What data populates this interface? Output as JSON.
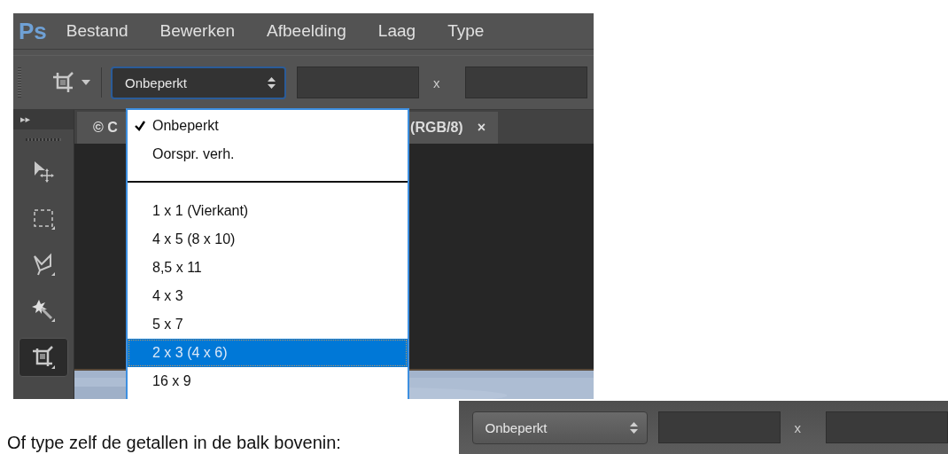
{
  "app_window": {
    "logo": "Ps",
    "menu": [
      {
        "label": "Bestand"
      },
      {
        "label": "Bewerken"
      },
      {
        "label": "Afbeelding"
      },
      {
        "label": "Laag"
      },
      {
        "label": "Type"
      }
    ],
    "options_bar": {
      "preset": "Onbeperkt",
      "separator": "x"
    },
    "tools": [
      {
        "kind": "move",
        "selected": false
      },
      {
        "kind": "marquee",
        "selected": false
      },
      {
        "kind": "lasso",
        "selected": false
      },
      {
        "kind": "wand",
        "selected": false
      },
      {
        "kind": "crop",
        "selected": true
      }
    ],
    "panel_toggle": "▸▸",
    "document_tab": {
      "title_start": "© C",
      "title_end": "(RGB/8)",
      "close": "×"
    },
    "dropdown": {
      "groups": [
        [
          {
            "label": "Onbeperkt",
            "checked": true,
            "selected": false
          },
          {
            "label": "Oorspr. verh.",
            "checked": false,
            "selected": false
          }
        ],
        [
          {
            "label": "1 x 1 (Vierkant)",
            "checked": false,
            "selected": false
          },
          {
            "label": "4 x 5 (8 x 10)",
            "checked": false,
            "selected": false
          },
          {
            "label": "8,5 x 11",
            "checked": false,
            "selected": false
          },
          {
            "label": "4 x 3",
            "checked": false,
            "selected": false
          },
          {
            "label": "5 x 7",
            "checked": false,
            "selected": false
          },
          {
            "label": "2 x 3 (4 x 6)",
            "checked": false,
            "selected": true
          },
          {
            "label": "16 x 9",
            "checked": false,
            "selected": false
          }
        ]
      ]
    }
  },
  "caption": "Of type zelf de getallen in de balk bovenin:",
  "options_bar_2": {
    "preset": "Onbeperkt",
    "separator": "x"
  }
}
